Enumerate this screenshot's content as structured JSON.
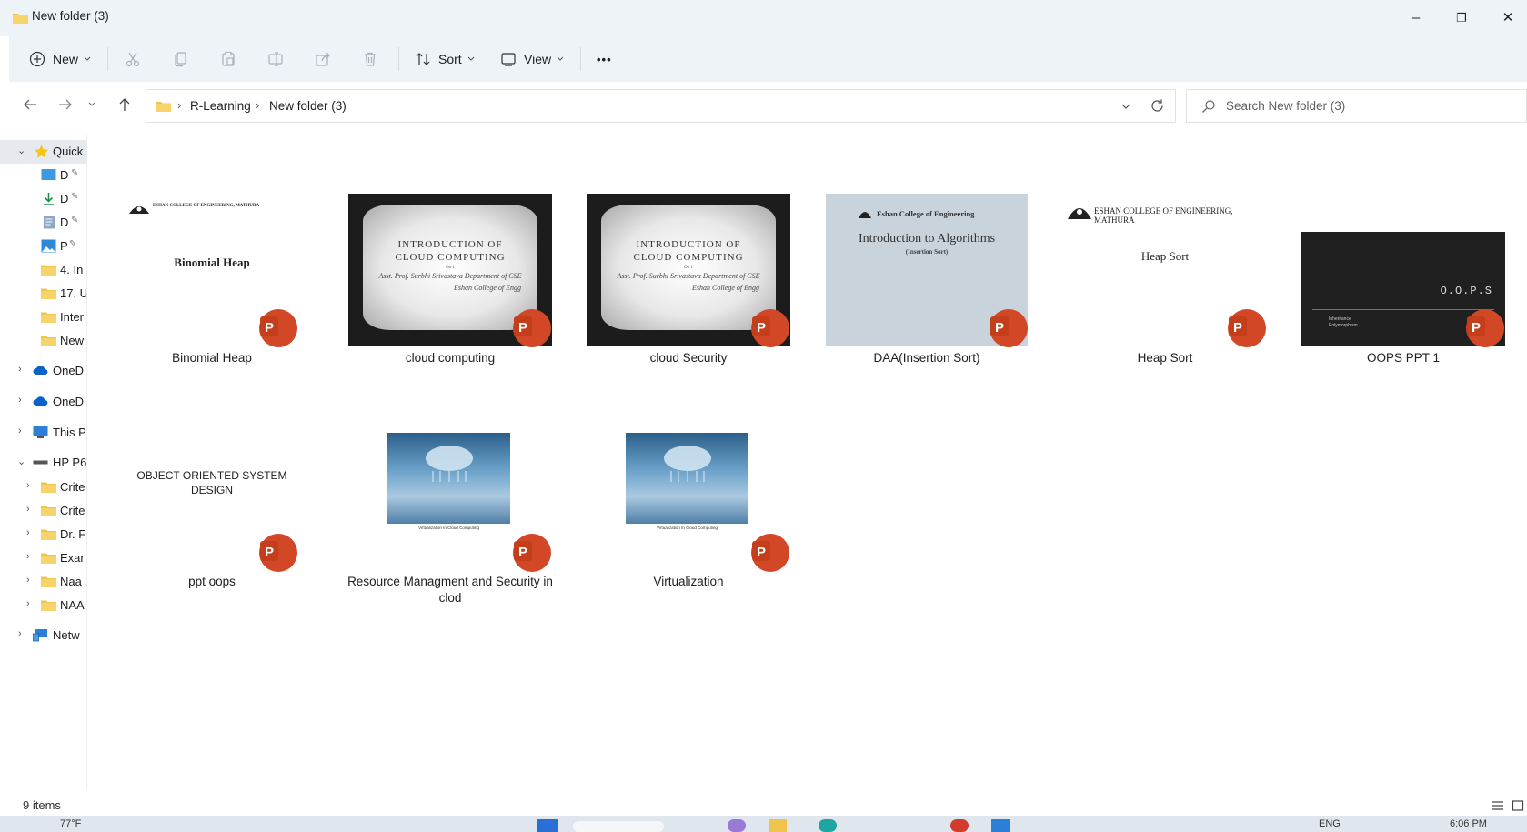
{
  "window": {
    "title": "New folder (3)",
    "controls": [
      "–",
      "❐",
      "✕"
    ]
  },
  "toolbar": {
    "new_label": "New",
    "sort_label": "Sort",
    "view_label": "View",
    "more_label": "•••"
  },
  "address": {
    "crumbs": [
      "R-Learning",
      "New folder (3)"
    ],
    "search_placeholder": "Search New folder (3)"
  },
  "navpane": {
    "items": [
      {
        "label": "Quick",
        "icon": "star-icon",
        "caret": "v"
      },
      {
        "label": "D",
        "icon": "desktop-icon",
        "pinned": true
      },
      {
        "label": "D",
        "icon": "download-icon",
        "pinned": true
      },
      {
        "label": "D",
        "icon": "documents-icon",
        "pinned": true
      },
      {
        "label": "P",
        "icon": "pictures-icon",
        "pinned": true
      },
      {
        "label": "4. In",
        "icon": "folder-icon"
      },
      {
        "label": "17. U",
        "icon": "folder-icon"
      },
      {
        "label": "Inter",
        "icon": "folder-icon"
      },
      {
        "label": "New",
        "icon": "folder-icon"
      },
      {
        "label": "OneD",
        "icon": "cloud-icon",
        "caret": ">"
      },
      {
        "label": "OneD",
        "icon": "cloud-icon",
        "caret": ">"
      },
      {
        "label": "This P",
        "icon": "monitor-icon",
        "caret": ">"
      },
      {
        "label": "HP P6",
        "icon": "drive-icon",
        "caret": "v"
      },
      {
        "label": "Crite",
        "icon": "folder-icon",
        "caret": ">"
      },
      {
        "label": "Crite",
        "icon": "folder-icon",
        "caret": ">"
      },
      {
        "label": "Dr. F",
        "icon": "folder-icon",
        "caret": ">"
      },
      {
        "label": "Exar",
        "icon": "folder-icon",
        "caret": ">"
      },
      {
        "label": "Naa",
        "icon": "folder-icon",
        "caret": ">"
      },
      {
        "label": "NAA",
        "icon": "folder-icon",
        "caret": ">"
      },
      {
        "label": "Netw",
        "icon": "network-icon",
        "caret": ">"
      }
    ]
  },
  "files": [
    {
      "name": "Binomial Heap",
      "slide": {
        "header": "ESHAN COLLEGE OF ENGINEERING, MATHURA",
        "title": "Binomial Heap"
      }
    },
    {
      "name": "cloud computing",
      "slide": {
        "line1": "INTRODUCTION OF",
        "line2": "CLOUD COMPUTING",
        "by": "On 1",
        "author": "Asst. Prof. Surbhi Srivastava Department of CSE",
        "college": "Eshan College of Engg"
      }
    },
    {
      "name": "cloud Security",
      "slide": {
        "line1": "INTRODUCTION OF",
        "line2": "CLOUD COMPUTING",
        "by": "On 1",
        "author": "Asst. Prof. Surbhi Srivastava Department of CSE",
        "college": "Eshan College of Engg"
      }
    },
    {
      "name": "DAA(Insertion Sort)",
      "slide": {
        "header": "Eshan College of Engineering",
        "title": "Introduction to Algorithms",
        "subtitle": "(Insertion Sort)"
      }
    },
    {
      "name": "Heap Sort",
      "slide": {
        "header": "ESHAN COLLEGE OF ENGINEERING, MATHURA",
        "title": "Heap Sort"
      }
    },
    {
      "name": "OOPS PPT 1",
      "slide": {
        "title": "O.O.P.S",
        "bullets": [
          "Inheritance",
          "Polymorphism"
        ]
      }
    },
    {
      "name": "ppt oops",
      "slide": {
        "title": "OBJECT ORIENTED SYSTEM DESIGN"
      }
    },
    {
      "name": "Resource Managment and Security in clod",
      "slide": {
        "caption": "Virtualization In Cloud Computing"
      }
    },
    {
      "name": "Virtualization",
      "slide": {
        "caption": "Virtualization In Cloud Computing"
      }
    }
  ],
  "status": {
    "item_count": "9 items"
  },
  "taskbar": {
    "weather": "77°F",
    "lang": "ENG",
    "time": "6:06 PM"
  },
  "colors": {
    "ppt_badge": "#d24726",
    "folder": "#f0c44c",
    "accent": "#0078d4"
  }
}
